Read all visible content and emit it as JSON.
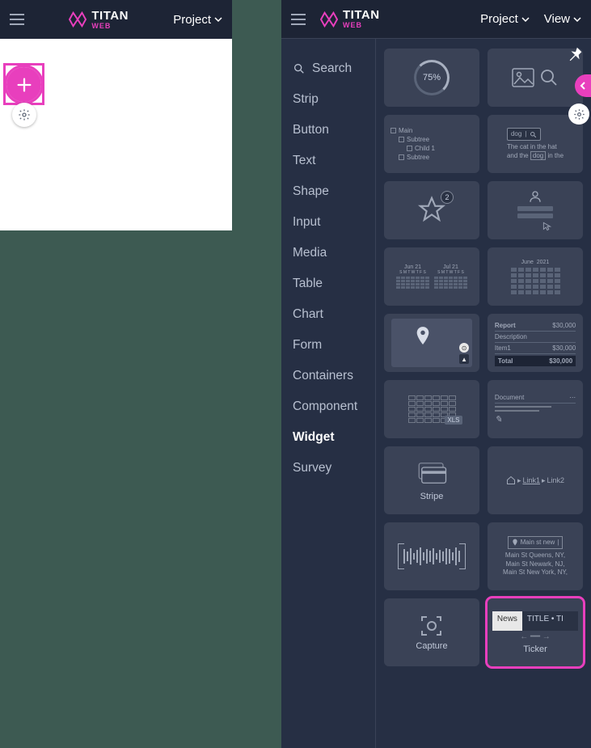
{
  "brand": {
    "name": "TITAN",
    "sub": "WEB"
  },
  "header": {
    "project": "Project",
    "view": "View"
  },
  "categories": [
    "Search",
    "Strip",
    "Button",
    "Text",
    "Shape",
    "Input",
    "Media",
    "Table",
    "Chart",
    "Form",
    "Containers",
    "Component",
    "Widget",
    "Survey"
  ],
  "active_category": "Widget",
  "widgets": {
    "progress_pct": "75%",
    "tree": {
      "main": "Main",
      "subtree": "Subtree",
      "child": "Child 1",
      "subtree2": "Subtree"
    },
    "find": {
      "word": "dog",
      "sentence_a": "The cat in the hat",
      "sentence_b": "and the",
      "sentence_c": "in the"
    },
    "rating_count": "2",
    "calendar_dual": {
      "left": "Jun 21",
      "right": "Jul 21",
      "days": "S M T W T F S"
    },
    "calendar_single": {
      "month": "June",
      "year": "2021"
    },
    "report": {
      "title": "Report",
      "amt1": "$30,000",
      "desc": "Description",
      "item": "Item1",
      "amt2": "$30,000",
      "total": "Total",
      "total_amt": "$30,000"
    },
    "xls": "XLS",
    "document": {
      "title": "Document"
    },
    "stripe": "Stripe",
    "breadcrumb": {
      "l1": "Link1",
      "l2": "Link2"
    },
    "address": {
      "main": "Main st new",
      "l1": "Main St Queens, NY,",
      "l2": "Main St Newark, NJ,",
      "l3": "Main St New York, NY,"
    },
    "capture": "Capture",
    "ticker": {
      "news": "News",
      "title": "TITLE  •  TI",
      "label": "Ticker"
    }
  }
}
